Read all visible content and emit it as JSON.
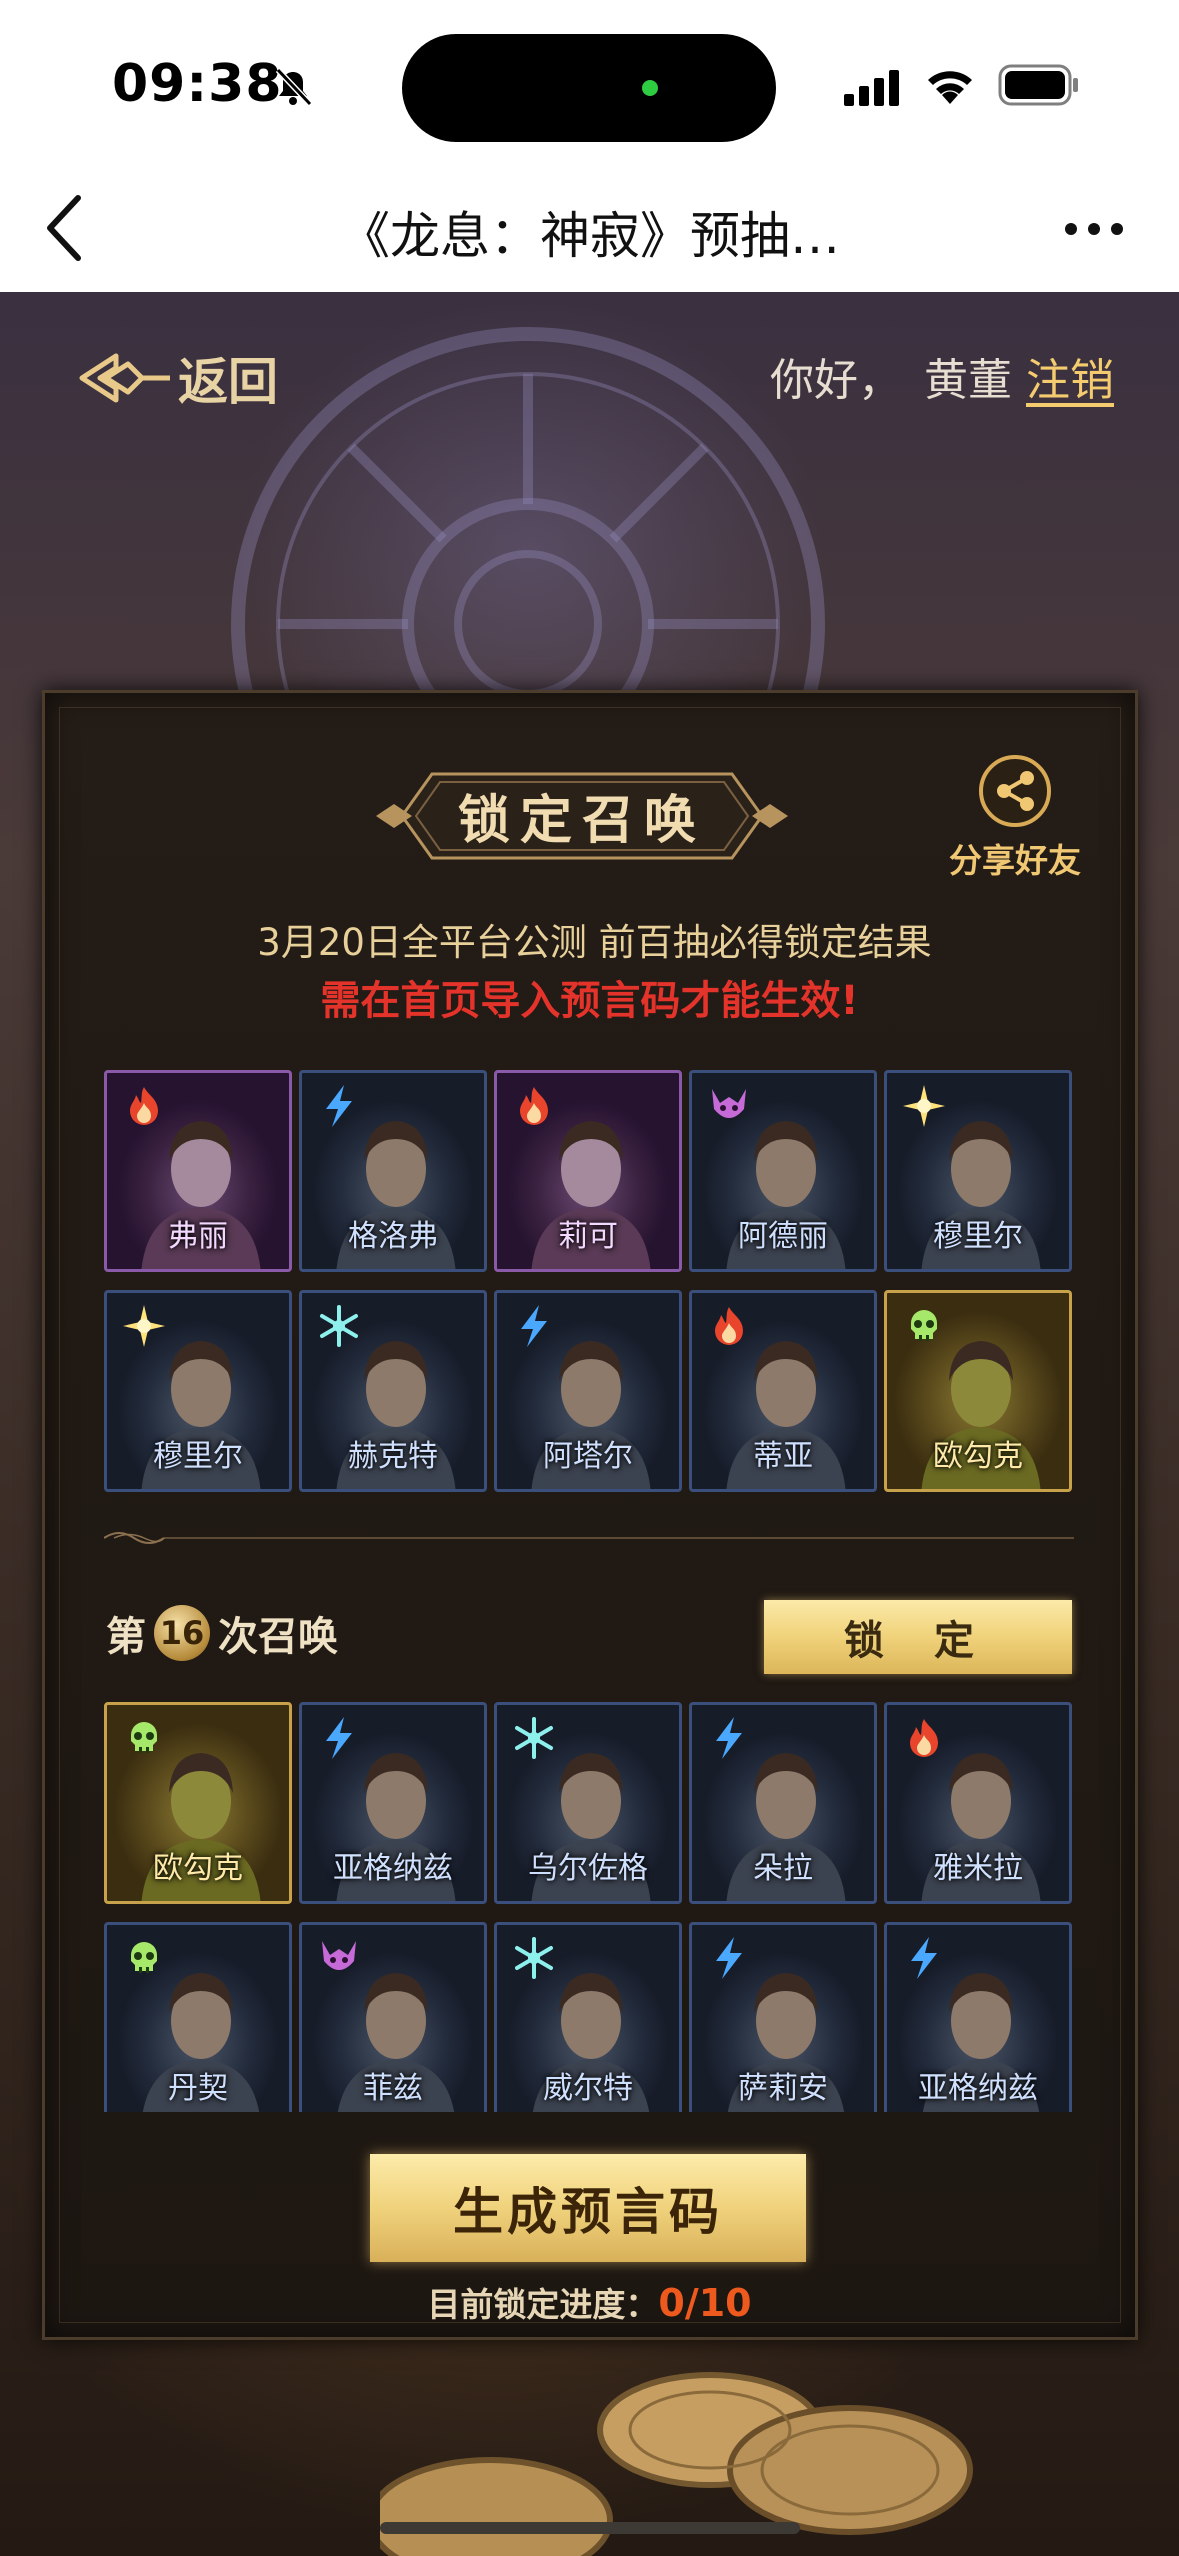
{
  "status_bar": {
    "time": "09:38"
  },
  "nav": {
    "title": "《龙息：神寂》预抽…"
  },
  "header": {
    "back_label": "返回",
    "greeting": "你好，",
    "user_name": "黄董",
    "logout_label": "注销"
  },
  "panel": {
    "title": "锁定召唤",
    "share_label": "分享好友",
    "info_line1": "3月20日全平台公测 前百抽必得锁定结果",
    "info_line2": "需在首页导入预言码才能生效!"
  },
  "locked_heroes": [
    {
      "name": "弗丽",
      "element": "fire",
      "rarity": "purple"
    },
    {
      "name": "格洛弗",
      "element": "lightning",
      "rarity": "blue"
    },
    {
      "name": "莉可",
      "element": "fire",
      "rarity": "purple"
    },
    {
      "name": "阿德丽",
      "element": "demon",
      "rarity": "blue"
    },
    {
      "name": "穆里尔",
      "element": "light",
      "rarity": "blue"
    },
    {
      "name": "穆里尔",
      "element": "light",
      "rarity": "blue"
    },
    {
      "name": "赫克特",
      "element": "ice",
      "rarity": "blue"
    },
    {
      "name": "阿塔尔",
      "element": "lightning",
      "rarity": "blue"
    },
    {
      "name": "蒂亚",
      "element": "fire",
      "rarity": "blue"
    },
    {
      "name": "欧勾克",
      "element": "poison",
      "rarity": "gold"
    }
  ],
  "summon": {
    "prefix": "第",
    "count": "16",
    "suffix": "次召唤",
    "lock_label": "锁 定"
  },
  "summon_heroes": [
    {
      "name": "欧勾克",
      "element": "poison",
      "rarity": "gold"
    },
    {
      "name": "亚格纳兹",
      "element": "lightning",
      "rarity": "blue"
    },
    {
      "name": "乌尔佐格",
      "element": "ice",
      "rarity": "blue"
    },
    {
      "name": "朵拉",
      "element": "lightning",
      "rarity": "blue"
    },
    {
      "name": "雅米拉",
      "element": "fire",
      "rarity": "blue"
    },
    {
      "name": "丹契",
      "element": "poison",
      "rarity": "blue"
    },
    {
      "name": "菲兹",
      "element": "demon",
      "rarity": "blue"
    },
    {
      "name": "威尔特",
      "element": "ice",
      "rarity": "blue"
    },
    {
      "name": "萨莉安",
      "element": "lightning",
      "rarity": "blue"
    },
    {
      "name": "亚格纳兹",
      "element": "lightning",
      "rarity": "blue"
    }
  ],
  "footer": {
    "generate_label": "生成预言码",
    "progress_label": "目前锁定进度：",
    "progress_value": "0/10"
  },
  "colors": {
    "gold_text": "#f0c772",
    "warning_red": "#e3332a",
    "progress_orange": "#ee5a1e",
    "card_blue": "#3b4f7c",
    "card_purple": "#8a5aa8",
    "card_gold": "#c7a24a"
  },
  "icons": {
    "fire": "fire-icon",
    "lightning": "lightning-icon",
    "ice": "ice-icon",
    "demon": "demon-icon",
    "light": "light-icon",
    "poison": "poison-icon"
  }
}
